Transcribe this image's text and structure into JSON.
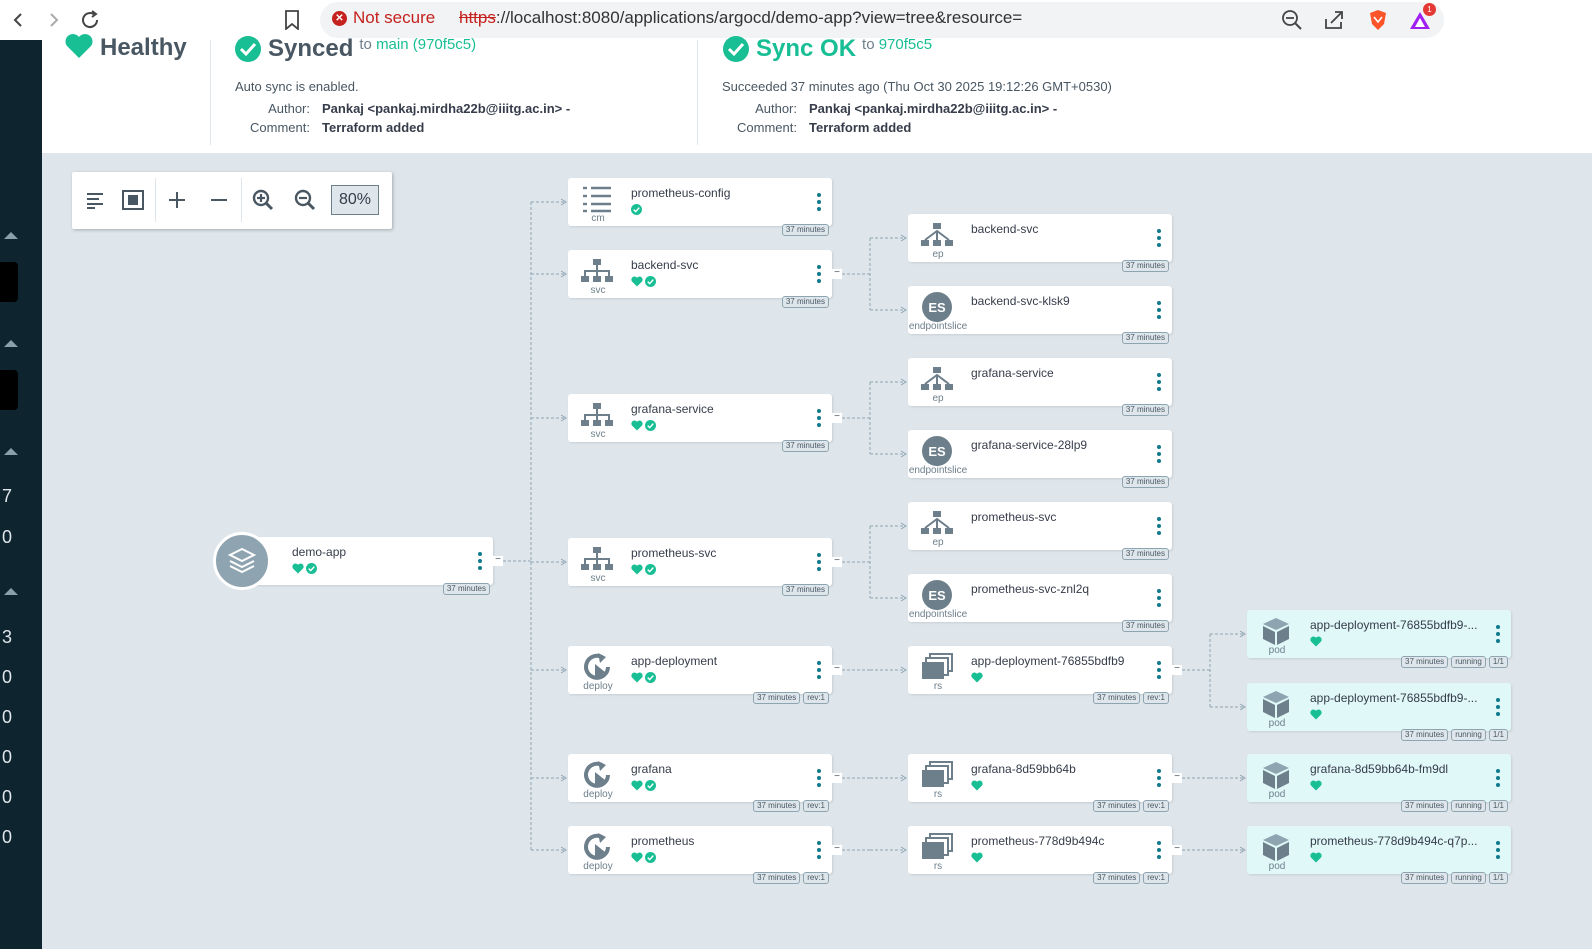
{
  "browser": {
    "not_secure": "Not secure",
    "url_scheme": "https",
    "url_rest": "://localhost:8080/applications/argocd/demo-app?view=tree&resource=",
    "brave_badge": "1"
  },
  "leftnav": {
    "numbers": [
      "7",
      "0",
      "3",
      "0",
      "0",
      "0",
      "0",
      "0"
    ]
  },
  "status": {
    "health": "Healthy",
    "sync": {
      "title": "Synced",
      "to": "to",
      "revision_prefix": "main",
      "revision": "(970f5c5)",
      "auto_sync": "Auto sync is enabled.",
      "author_label": "Author:",
      "author": "Pankaj <pankaj.mirdha22b@iiitg.ac.in> -",
      "comment_label": "Comment:",
      "comment": "Terraform added"
    },
    "operation": {
      "title": "Sync OK",
      "to": "to",
      "revision": "970f5c5",
      "succeeded": "Succeeded 37 minutes ago (Thu Oct 30 2025 19:12:26 GMT+0530)",
      "author_label": "Author:",
      "author": "Pankaj <pankaj.mirdha22b@iiitg.ac.in> -",
      "comment_label": "Comment:",
      "comment": "Terraform added"
    }
  },
  "toolbar": {
    "zoom": "80%"
  },
  "root": {
    "name": "demo-app",
    "age": "37 minutes"
  },
  "nodes": [
    {
      "id": "prometheus-config",
      "name": "prometheus-config",
      "kind": "cm",
      "health": false,
      "sync": true,
      "tags": [
        "37 minutes"
      ],
      "pod": false
    },
    {
      "id": "backend-svc",
      "name": "backend-svc",
      "kind": "svc",
      "health": true,
      "sync": true,
      "tags": [
        "37 minutes"
      ],
      "pod": false
    },
    {
      "id": "grafana-service",
      "name": "grafana-service",
      "kind": "svc",
      "health": true,
      "sync": true,
      "tags": [
        "37 minutes"
      ],
      "pod": false
    },
    {
      "id": "prometheus-svc",
      "name": "prometheus-svc",
      "kind": "svc",
      "health": true,
      "sync": true,
      "tags": [
        "37 minutes"
      ],
      "pod": false
    },
    {
      "id": "app-deployment",
      "name": "app-deployment",
      "kind": "deploy",
      "health": true,
      "sync": true,
      "tags": [
        "37 minutes",
        "rev:1"
      ],
      "pod": false
    },
    {
      "id": "grafana",
      "name": "grafana",
      "kind": "deploy",
      "health": true,
      "sync": true,
      "tags": [
        "37 minutes",
        "rev:1"
      ],
      "pod": false
    },
    {
      "id": "prometheus",
      "name": "prometheus",
      "kind": "deploy",
      "health": true,
      "sync": true,
      "tags": [
        "37 minutes",
        "rev:1"
      ],
      "pod": false
    },
    {
      "id": "backend-svc-ep",
      "name": "backend-svc",
      "kind": "ep",
      "health": false,
      "sync": false,
      "tags": [
        "37 minutes"
      ],
      "pod": false
    },
    {
      "id": "backend-svc-klsk9",
      "name": "backend-svc-klsk9",
      "kind": "endpointslice",
      "health": false,
      "sync": false,
      "tags": [
        "37 minutes"
      ],
      "pod": false
    },
    {
      "id": "grafana-service-ep",
      "name": "grafana-service",
      "kind": "ep",
      "health": false,
      "sync": false,
      "tags": [
        "37 minutes"
      ],
      "pod": false
    },
    {
      "id": "grafana-service-28lp9",
      "name": "grafana-service-28lp9",
      "kind": "endpointslice",
      "health": false,
      "sync": false,
      "tags": [
        "37 minutes"
      ],
      "pod": false
    },
    {
      "id": "prometheus-svc-ep",
      "name": "prometheus-svc",
      "kind": "ep",
      "health": false,
      "sync": false,
      "tags": [
        "37 minutes"
      ],
      "pod": false
    },
    {
      "id": "prometheus-svc-znl2q",
      "name": "prometheus-svc-znl2q",
      "kind": "endpointslice",
      "health": false,
      "sync": false,
      "tags": [
        "37 minutes"
      ],
      "pod": false
    },
    {
      "id": "app-deployment-rs",
      "name": "app-deployment-76855bdfb9",
      "kind": "rs",
      "health": true,
      "sync": false,
      "tags": [
        "37 minutes",
        "rev:1"
      ],
      "pod": false
    },
    {
      "id": "grafana-rs",
      "name": "grafana-8d59bb64b",
      "kind": "rs",
      "health": true,
      "sync": false,
      "tags": [
        "37 minutes",
        "rev:1"
      ],
      "pod": false
    },
    {
      "id": "prometheus-rs",
      "name": "prometheus-778d9b494c",
      "kind": "rs",
      "health": true,
      "sync": false,
      "tags": [
        "37 minutes",
        "rev:1"
      ],
      "pod": false
    },
    {
      "id": "app-pod-1",
      "name": "app-deployment-76855bdfb9-...",
      "kind": "pod",
      "health": true,
      "sync": false,
      "tags": [
        "37 minutes",
        "running",
        "1/1"
      ],
      "pod": true
    },
    {
      "id": "app-pod-2",
      "name": "app-deployment-76855bdfb9-...",
      "kind": "pod",
      "health": true,
      "sync": false,
      "tags": [
        "37 minutes",
        "running",
        "1/1"
      ],
      "pod": true
    },
    {
      "id": "grafana-pod",
      "name": "grafana-8d59bb64b-fm9dl",
      "kind": "pod",
      "health": true,
      "sync": false,
      "tags": [
        "37 minutes",
        "running",
        "1/1"
      ],
      "pod": true
    },
    {
      "id": "prometheus-pod",
      "name": "prometheus-778d9b494c-q7p...",
      "kind": "pod",
      "health": true,
      "sync": false,
      "tags": [
        "37 minutes",
        "running",
        "1/1"
      ],
      "pod": true
    }
  ],
  "colors": {
    "healthy": "#18be94",
    "menu": "#0e7a8c",
    "graph_bg": "#dee6eb",
    "nav_bg": "#0e242f"
  }
}
